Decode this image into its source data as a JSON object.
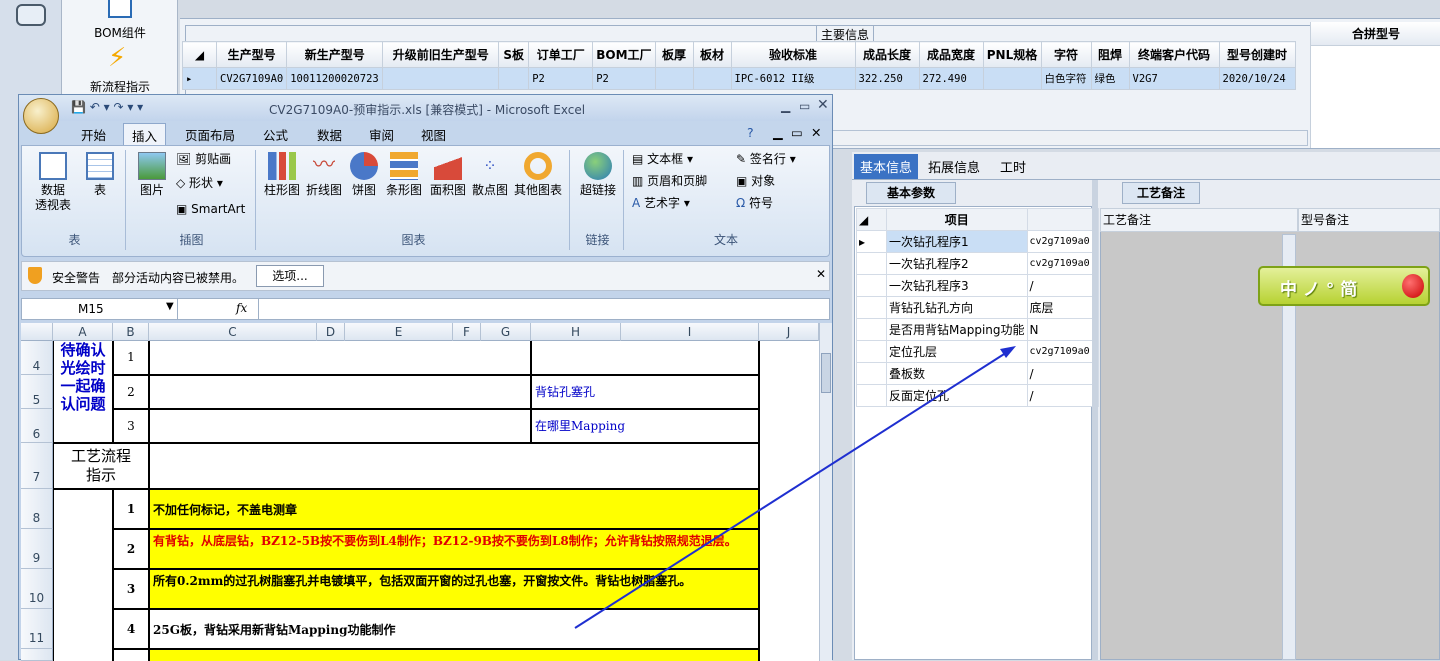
{
  "launcher": {
    "bom_label": "BOM组件",
    "flow_label": "新流程指示"
  },
  "main_grid": {
    "group_title": "主要信息",
    "headers": [
      "生产型号",
      "新生产型号",
      "升级前旧生产型号",
      "S板",
      "订单工厂",
      "BOM工厂",
      "板厚",
      "板材",
      "验收标准",
      "成品长度",
      "成品宽度",
      "PNL规格",
      "字符",
      "阻焊",
      "终端客户代码",
      "型号创建时"
    ],
    "row": [
      "CV2G7109A0",
      "10011200020723",
      "",
      "",
      "P2",
      "P2",
      "",
      "",
      "IPC-6012 II级",
      "322.250",
      "272.490",
      "",
      "白色字符",
      "绿色",
      "V2G7",
      "2020/10/24"
    ],
    "side_header": "合拼型号"
  },
  "excel": {
    "title": "CV2G7109A0-预审指示.xls  [兼容模式] - Microsoft Excel",
    "tabs": [
      "开始",
      "插入",
      "页面布局",
      "公式",
      "数据",
      "审阅",
      "视图"
    ],
    "active_tab": "插入",
    "ribbon": {
      "groups": {
        "table": "表",
        "illustrations": "插图",
        "charts": "图表",
        "links": "链接",
        "text": "文本"
      },
      "pivot": "数据\n透视表",
      "table_btn": "表",
      "picture": "图片",
      "clipart": "剪贴画",
      "shapes": "形状",
      "smartart": "SmartArt",
      "charts": [
        "柱形图",
        "折线图",
        "饼图",
        "条形图",
        "面积图",
        "散点图",
        "其他图表"
      ],
      "hyperlink": "超链接",
      "textbox": "文本框",
      "headerfooter": "页眉和页脚",
      "wordart": "艺术字",
      "signature": "签名行",
      "object": "对象",
      "symbol": "符号"
    },
    "security": {
      "title": "安全警告",
      "message": "部分活动内容已被禁用。",
      "options": "选项..."
    },
    "namebox": "M15",
    "fx": "fx",
    "columns": [
      "A",
      "B",
      "C",
      "D",
      "E",
      "F",
      "G",
      "H",
      "I",
      "J"
    ],
    "rows": {
      "r4_label": "待确认\n光绘时\n一起确\n认问题",
      "n1": "1",
      "n2": "2",
      "n3": "3",
      "h5": "背钻孔塞孔",
      "h6": "在哪里Mapping",
      "flow_label": "工艺流程\n指示",
      "i1": "1",
      "i2": "2",
      "i3": "3",
      "i4": "4",
      "t8": "不加任何标记，不盖电测章",
      "t9": "有背钻，从底层钻，BZ12-5B按不要伤到L4制作；BZ12-9B按不要伤到L8制作；允许背钻按照规范退层。",
      "t10": "所有0.2mm的过孔树脂塞孔并电镀填平，包括双面开窗的过孔也塞，开窗按文件。背钻也树脂塞孔。",
      "t11": "25G板，背钻采用新背钻Mapping功能制作"
    },
    "row_numbers": [
      "4",
      "5",
      "6",
      "7",
      "8",
      "9",
      "10",
      "11"
    ]
  },
  "right_panel": {
    "tabs": [
      "基本信息",
      "拓展信息",
      "工时"
    ],
    "sub_tab": "基本参数",
    "craft_tab": "工艺备注",
    "col_item": "项目",
    "craft_col1": "工艺备注",
    "craft_col2": "型号备注",
    "params": [
      {
        "name": "一次钻孔程序1",
        "value": "cv2g7109a0."
      },
      {
        "name": "一次钻孔程序2",
        "value": "cv2g7109a0."
      },
      {
        "name": "一次钻孔程序3",
        "value": "/"
      },
      {
        "name": "背钻孔钻孔方向",
        "value": "底层"
      },
      {
        "name": "是否用背钻Mapping功能",
        "value": "N"
      },
      {
        "name": "定位孔层",
        "value": "cv2g7109a0."
      },
      {
        "name": "叠板数",
        "value": "/"
      },
      {
        "name": "反面定位孔",
        "value": "/"
      }
    ]
  },
  "badge": {
    "text": "中 ノ ° 简"
  },
  "colors": {
    "yellow": "#ffff00",
    "red_text": "#e00000",
    "blue_text": "#0000c8",
    "arrow": "#1f2fd0",
    "selected_row": "#c9def5"
  }
}
